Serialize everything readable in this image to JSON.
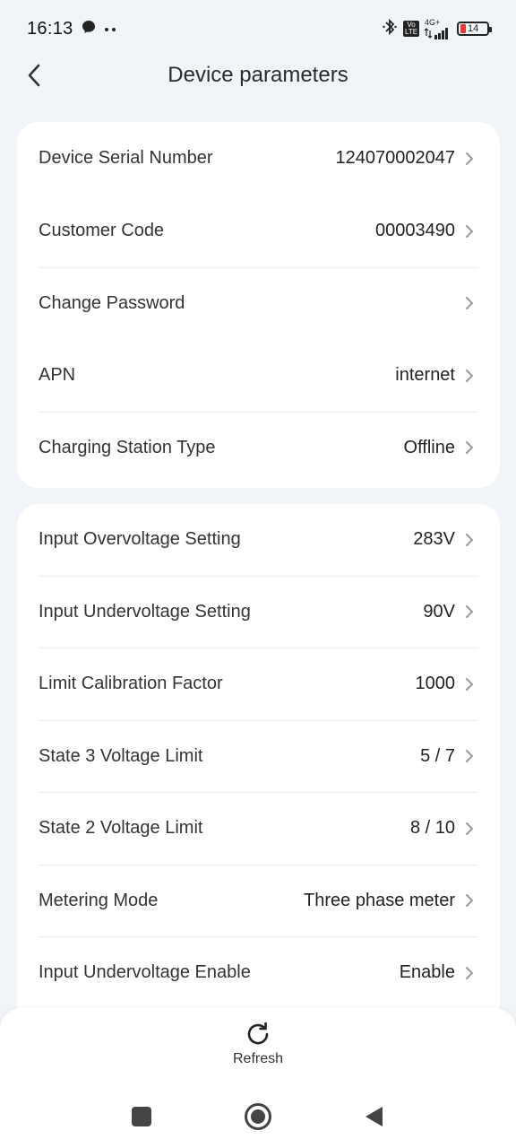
{
  "status_bar": {
    "time": "16:13",
    "network_top": "4G+",
    "volte_label": "Vo LTE",
    "battery_level": "14",
    "icons": [
      "messenger-icon",
      "more-dots-icon",
      "bluetooth-icon",
      "volte-icon",
      "signal-icon",
      "battery-icon"
    ]
  },
  "header": {
    "title": "Device parameters",
    "back_icon": "chevron-left-icon"
  },
  "card_1": {
    "rows": [
      {
        "label": "Device Serial Number",
        "value": "124070002047"
      },
      {
        "label": "Customer Code",
        "value": "00003490"
      },
      {
        "label": "Change Password",
        "value": ""
      },
      {
        "label": "APN",
        "value": "internet"
      },
      {
        "label": "Charging Station Type",
        "value": "Offline"
      }
    ]
  },
  "card_2": {
    "rows": [
      {
        "label": "Input Overvoltage Setting",
        "value": "283V"
      },
      {
        "label": "Input Undervoltage Setting",
        "value": "90V"
      },
      {
        "label": "Limit Calibration Factor",
        "value": "1000"
      },
      {
        "label": "State 3 Voltage Limit",
        "value": "5 / 7"
      },
      {
        "label": "State 2 Voltage Limit",
        "value": "8 / 10"
      },
      {
        "label": "Metering Mode",
        "value": "Three phase meter"
      },
      {
        "label": "Input Undervoltage Enable",
        "value": "Enable"
      }
    ]
  },
  "bottom": {
    "refresh_label": "Refresh",
    "refresh_icon": "refresh-icon"
  },
  "nav": {
    "icons": [
      "recents-square-icon",
      "home-circle-icon",
      "back-triangle-icon"
    ]
  },
  "colors": {
    "background": "#f1f4f8",
    "card": "#ffffff",
    "battery_low": "#e53935",
    "chevron": "#9a9a9a"
  }
}
